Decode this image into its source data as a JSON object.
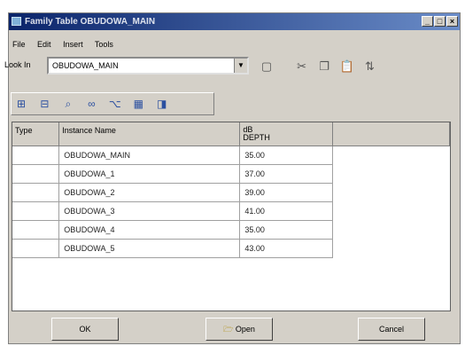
{
  "window": {
    "title": "Family Table OBUDOWA_MAIN"
  },
  "menu": {
    "items": [
      "File",
      "Edit",
      "Insert",
      "Tools"
    ]
  },
  "lookin": {
    "label": "Look In",
    "value": "OBUDOWA_MAIN"
  },
  "table": {
    "headers": {
      "type": "Type",
      "name": "Instance Name",
      "unit": "dB",
      "depth": "DEPTH"
    },
    "rows": [
      {
        "name": "OBUDOWA_MAIN",
        "depth": "35.00"
      },
      {
        "name": "OBUDOWA_1",
        "depth": "37.00"
      },
      {
        "name": "OBUDOWA_2",
        "depth": "39.00"
      },
      {
        "name": "OBUDOWA_3",
        "depth": "41.00"
      },
      {
        "name": "OBUDOWA_4",
        "depth": "35.00"
      },
      {
        "name": "OBUDOWA_5",
        "depth": "43.00"
      }
    ]
  },
  "buttons": {
    "ok": "OK",
    "open": "Open",
    "cancel": "Cancel"
  }
}
